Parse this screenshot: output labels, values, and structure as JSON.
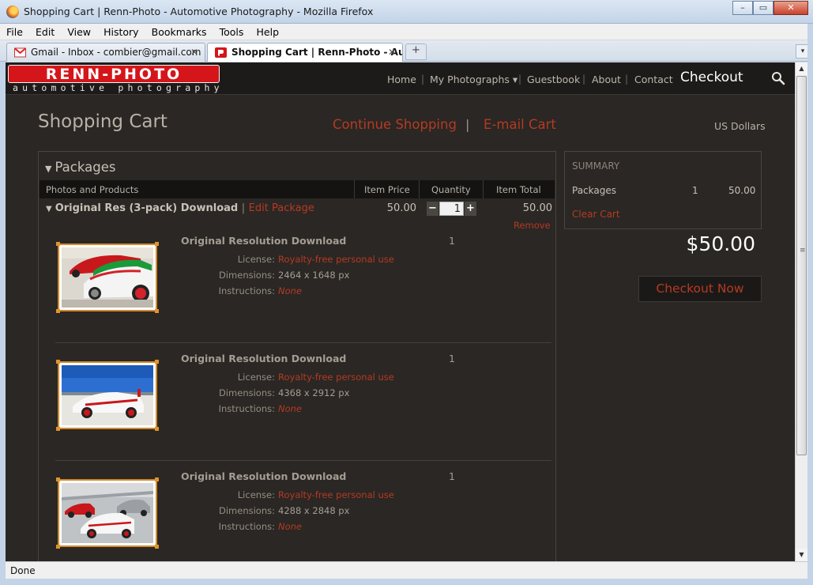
{
  "window": {
    "title": "Shopping Cart | Renn-Photo - Automotive Photography - Mozilla Firefox",
    "minimize": "–",
    "restore": "▭",
    "close": "✕"
  },
  "menu": [
    "File",
    "Edit",
    "View",
    "History",
    "Bookmarks",
    "Tools",
    "Help"
  ],
  "tabs": [
    {
      "label": "Gmail - Inbox - combier@gmail.com",
      "close": "✕"
    },
    {
      "label": "Shopping Cart | Renn-Photo - Aut...",
      "close": "✕"
    }
  ],
  "new_tab": "+",
  "tab_list": "▾",
  "status": "Done",
  "site": {
    "logo": "RENN-PHOTO",
    "logo_sub": "automotive photography",
    "nav": {
      "home": "Home",
      "photos": "My Photographs ▾",
      "guestbook": "Guestbook",
      "about": "About",
      "contact": "Contact",
      "checkout": "Checkout"
    },
    "nav_sep": "|"
  },
  "page": {
    "title": "Shopping Cart",
    "continue": "Continue Shopping",
    "sep": "|",
    "email": "E-mail Cart",
    "currency": "US Dollars"
  },
  "cart": {
    "heading": "Packages",
    "columns": {
      "products": "Photos and Products",
      "price": "Item Price",
      "quantity": "Quantity",
      "total": "Item Total"
    },
    "package": {
      "name": "Original Res (3-pack) Download",
      "bar": "|",
      "edit": "Edit Package",
      "price": "50.00",
      "qty": "1",
      "total": "50.00",
      "remove": "Remove",
      "minus": "−",
      "plus": "+"
    },
    "items": [
      {
        "name": "Original Resolution Download",
        "count": "1",
        "license_label": "License:",
        "license": "Royalty-free personal use",
        "dim_label": "Dimensions:",
        "dimensions": "2464 x 1648 px",
        "instr_label": "Instructions:",
        "instructions": "None"
      },
      {
        "name": "Original Resolution Download",
        "count": "1",
        "license_label": "License:",
        "license": "Royalty-free personal use",
        "dim_label": "Dimensions:",
        "dimensions": "4368 x 2912 px",
        "instr_label": "Instructions:",
        "instructions": "None"
      },
      {
        "name": "Original Resolution Download",
        "count": "1",
        "license_label": "License:",
        "license": "Royalty-free personal use",
        "dim_label": "Dimensions:",
        "dimensions": "4288 x 2848 px",
        "instr_label": "Instructions:",
        "instructions": "None"
      }
    ]
  },
  "summary": {
    "heading": "SUMMARY",
    "label": "Packages",
    "count": "1",
    "amount": "50.00",
    "clear": "Clear Cart",
    "total": "$50.00",
    "checkout": "Checkout Now"
  },
  "colors": {
    "accent": "#b53a23",
    "background": "#2a2724",
    "logo_red": "#d4161a"
  }
}
